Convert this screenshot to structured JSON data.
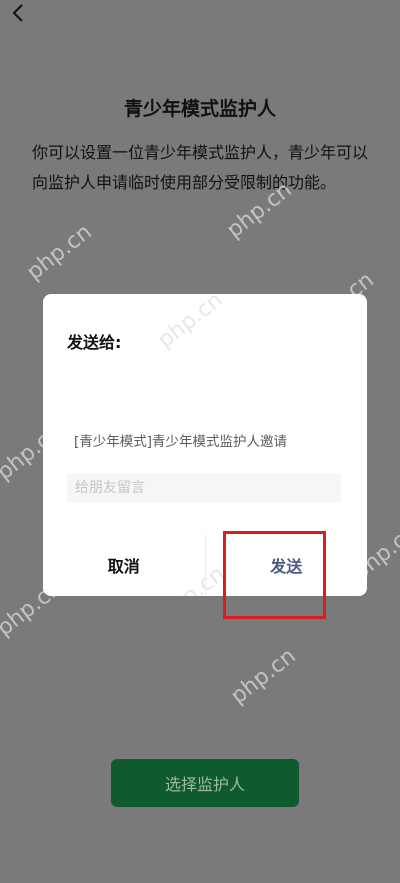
{
  "page": {
    "title": "青少年模式监护人",
    "description": "你可以设置一位青少年模式监护人，青少年可以向监护人申请临时使用部分受限制的功能。",
    "primary_button": "选择监护人"
  },
  "dialog": {
    "title": "发送给:",
    "invite_preview": "[青少年模式]青少年模式监护人邀请",
    "message_placeholder": "给朋友留言",
    "cancel_label": "取消",
    "send_label": "发送"
  },
  "watermark": "php.cn",
  "colors": {
    "overlay": "#7a7a7a",
    "primary_button": "#0f5a2f",
    "send_text": "#4a5a84",
    "highlight": "#d81e1e"
  },
  "icons": {
    "back": "chevron-left-icon"
  }
}
